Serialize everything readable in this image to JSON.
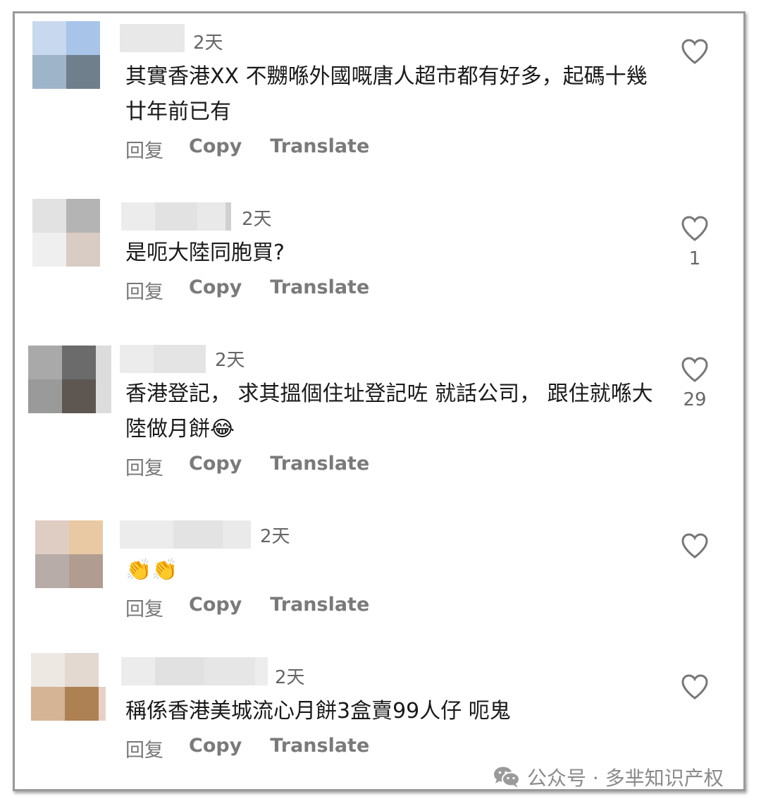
{
  "comments": [
    {
      "time": "2天",
      "text": "其實香港XX 不嬲喺外國嘅唐人超市都有好多，起碼十幾廿年前已有",
      "likes": "",
      "avatar_colors": [
        "#c8d9ef",
        "#a8c4e8",
        "#9eb4c9",
        "#6f7f8c"
      ]
    },
    {
      "time": "2天",
      "text": "是呃大陸同胞買?",
      "likes": "1",
      "avatar_colors": [
        "#e2e2e2",
        "#b4b4b4",
        "#efefef",
        "#d8ccc4"
      ]
    },
    {
      "time": "2天",
      "text": "香港登記， 求其搵個住址登記咗 就話公司， 跟住就喺大陸做月餅😂",
      "likes": "29",
      "avatar_colors": [
        "#a9a9a9",
        "#6b6b6b",
        "#9a9a9a",
        "#5d5651"
      ]
    },
    {
      "time": "2天",
      "text": "👏👏",
      "likes": "",
      "avatar_colors": [
        "#dfccc2",
        "#e9c9a4",
        "#b7aca7",
        "#b09c90"
      ]
    },
    {
      "time": "2天",
      "text": "稱係香港美城流心月餅3盒賣99人仔 呃鬼",
      "likes": "",
      "avatar_colors": [
        "#eee8e2",
        "#e3d9d0",
        "#d5b496",
        "#ad8154"
      ]
    }
  ],
  "actions": {
    "reply": "回复",
    "copy": "Copy",
    "translate": "Translate"
  },
  "icons": {
    "like": "heart-outline-icon",
    "watermark": "wechat-icon"
  },
  "watermark": {
    "text": "公众号 · 多芈知识产权"
  }
}
